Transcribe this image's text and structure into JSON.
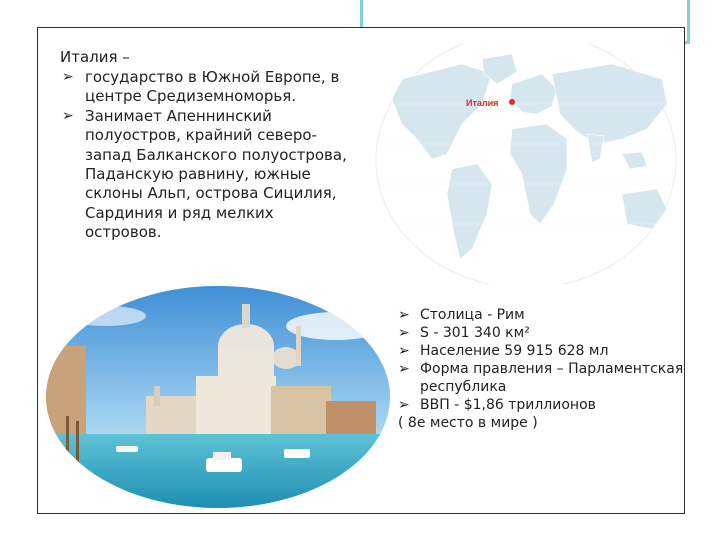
{
  "title": "Италия –",
  "bullets": [
    "государство в Южной Европе, в центре Средиземноморья.",
    "Занимает Апеннинский полуостров, крайний северо-запад Балканского полуострова, Паданскую равнину, южные склоны Альп, острова Сицилия, Сардиния и ряд мелких островов."
  ],
  "map": {
    "label": "Италия",
    "marker_color": "#d6312b",
    "ocean_color": "#ffffff",
    "land_color": "#cfe3ee"
  },
  "facts": [
    "Столица - Рим",
    "S - 301 340 км²",
    "Население  59 915 628 мл",
    "Форма правления – Парламентская республика",
    "ВВП - $1,86 триллионов"
  ],
  "facts_note": "( 8е место в мире )",
  "icons": {
    "bullet": "arrow-bullet-icon"
  },
  "colors": {
    "frame": "#2e2e2e",
    "accent": "#7fd1d4"
  }
}
